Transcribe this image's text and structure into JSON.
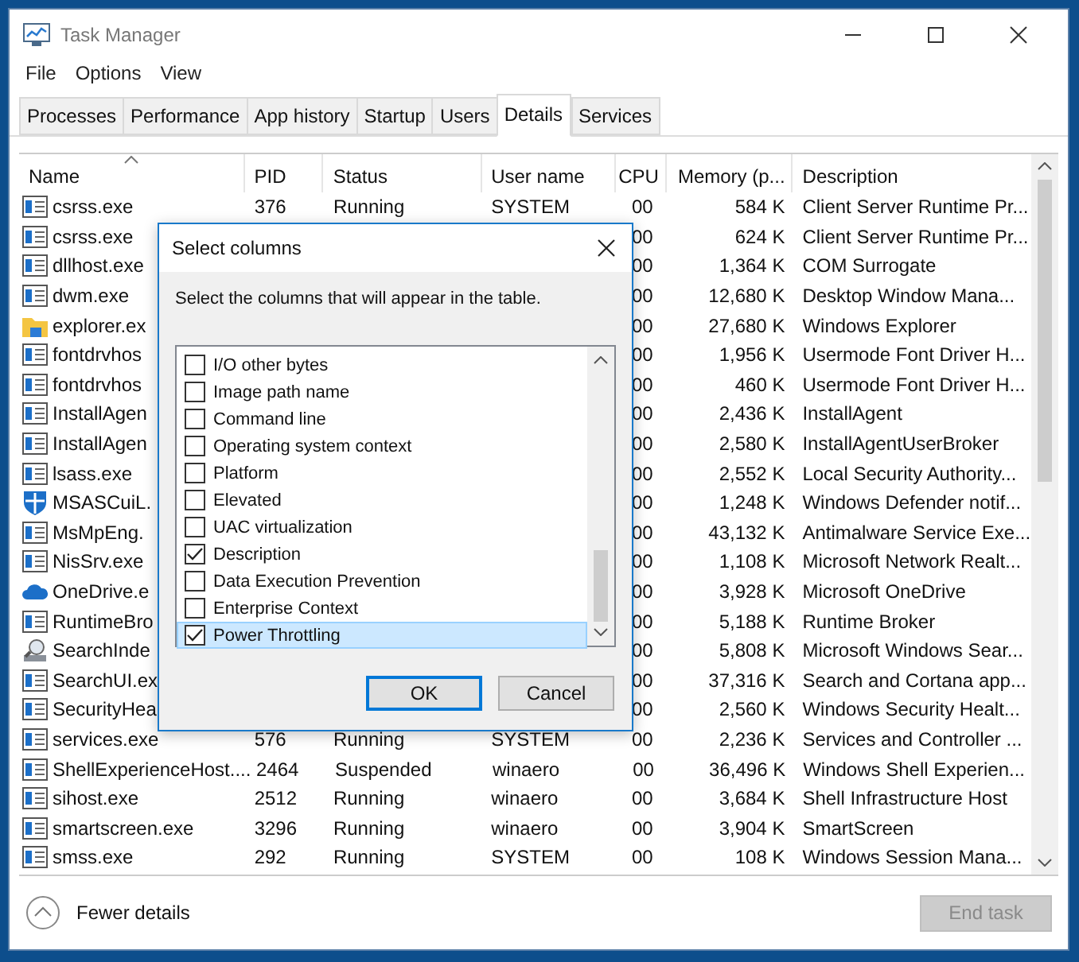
{
  "window": {
    "title": "Task Manager"
  },
  "menu": [
    "File",
    "Options",
    "View"
  ],
  "tabs": [
    {
      "label": "Processes",
      "selected": false
    },
    {
      "label": "Performance",
      "selected": false
    },
    {
      "label": "App history",
      "selected": false
    },
    {
      "label": "Startup",
      "selected": false
    },
    {
      "label": "Users",
      "selected": false
    },
    {
      "label": "Details",
      "selected": true
    },
    {
      "label": "Services",
      "selected": false
    }
  ],
  "table": {
    "columns": [
      {
        "label": "Name",
        "sorted": true
      },
      {
        "label": "PID",
        "sorted": false
      },
      {
        "label": "Status",
        "sorted": false
      },
      {
        "label": "User name",
        "sorted": false
      },
      {
        "label": "CPU",
        "sorted": false
      },
      {
        "label": "Memory (p...",
        "sorted": false
      },
      {
        "label": "Description",
        "sorted": false
      }
    ],
    "rows": [
      {
        "kind": "app",
        "name": "csrss.exe",
        "pid": "376",
        "status": "Running",
        "user": "SYSTEM",
        "cpu": "00",
        "memory": "584 K",
        "description": "Client Server Runtime Pr..."
      },
      {
        "kind": "app",
        "name": "csrss.exe",
        "cpu": "00",
        "memory": "624 K",
        "description": "Client Server Runtime Pr..."
      },
      {
        "kind": "app",
        "name": "dllhost.exe",
        "cpu": "00",
        "memory": "1,364 K",
        "description": "COM Surrogate"
      },
      {
        "kind": "app",
        "name": "dwm.exe",
        "cpu": "00",
        "memory": "12,680 K",
        "description": "Desktop Window Mana..."
      },
      {
        "kind": "folder",
        "name": "explorer.ex",
        "cpu": "00",
        "memory": "27,680 K",
        "description": "Windows Explorer"
      },
      {
        "kind": "app",
        "name": "fontdrvhos",
        "cpu": "00",
        "memory": "1,956 K",
        "description": "Usermode Font Driver H..."
      },
      {
        "kind": "app",
        "name": "fontdrvhos",
        "cpu": "00",
        "memory": "460 K",
        "description": "Usermode Font Driver H..."
      },
      {
        "kind": "app",
        "name": "InstallAgen",
        "cpu": "00",
        "memory": "2,436 K",
        "description": "InstallAgent"
      },
      {
        "kind": "app",
        "name": "InstallAgen",
        "cpu": "00",
        "memory": "2,580 K",
        "description": "InstallAgentUserBroker"
      },
      {
        "kind": "app",
        "name": "lsass.exe",
        "cpu": "00",
        "memory": "2,552 K",
        "description": "Local Security Authority..."
      },
      {
        "kind": "shield",
        "name": "MSASCuiL.",
        "cpu": "00",
        "memory": "1,248 K",
        "description": "Windows Defender notif..."
      },
      {
        "kind": "app",
        "name": "MsMpEng.",
        "cpu": "00",
        "memory": "43,132 K",
        "description": "Antimalware Service Exe..."
      },
      {
        "kind": "app",
        "name": "NisSrv.exe",
        "cpu": "00",
        "memory": "1,108 K",
        "description": "Microsoft Network Realt..."
      },
      {
        "kind": "cloud",
        "name": "OneDrive.e",
        "cpu": "00",
        "memory": "3,928 K",
        "description": "Microsoft OneDrive"
      },
      {
        "kind": "app",
        "name": "RuntimeBro",
        "cpu": "00",
        "memory": "5,188 K",
        "description": "Runtime Broker"
      },
      {
        "kind": "search",
        "name": "SearchInde",
        "cpu": "00",
        "memory": "5,808 K",
        "description": "Microsoft Windows Sear..."
      },
      {
        "kind": "app",
        "name": "SearchUI.ex",
        "cpu": "00",
        "memory": "37,316 K",
        "description": "Search and Cortana app..."
      },
      {
        "kind": "app",
        "name": "SecurityHea",
        "cpu": "00",
        "memory": "2,560 K",
        "description": "Windows Security Healt..."
      },
      {
        "kind": "app",
        "name": "services.exe",
        "pid": "576",
        "status": "Running",
        "user": "SYSTEM",
        "cpu": "00",
        "memory": "2,236 K",
        "description": "Services and Controller ..."
      },
      {
        "kind": "app",
        "name": "ShellExperienceHost....",
        "pid": "2464",
        "status": "Suspended",
        "user": "winaero",
        "cpu": "00",
        "memory": "36,496 K",
        "description": "Windows Shell Experien..."
      },
      {
        "kind": "app",
        "name": "sihost.exe",
        "pid": "2512",
        "status": "Running",
        "user": "winaero",
        "cpu": "00",
        "memory": "3,684 K",
        "description": "Shell Infrastructure Host"
      },
      {
        "kind": "app",
        "name": "smartscreen.exe",
        "pid": "3296",
        "status": "Running",
        "user": "winaero",
        "cpu": "00",
        "memory": "3,904 K",
        "description": "SmartScreen"
      },
      {
        "kind": "app",
        "name": "smss.exe",
        "pid": "292",
        "status": "Running",
        "user": "SYSTEM",
        "cpu": "00",
        "memory": "108 K",
        "description": "Windows Session Mana..."
      }
    ]
  },
  "dialog": {
    "title": "Select columns",
    "instruction": "Select the columns that will appear in the table.",
    "options": [
      {
        "label": "I/O other bytes",
        "checked": false,
        "selected": false
      },
      {
        "label": "Image path name",
        "checked": false,
        "selected": false
      },
      {
        "label": "Command line",
        "checked": false,
        "selected": false
      },
      {
        "label": "Operating system context",
        "checked": false,
        "selected": false
      },
      {
        "label": "Platform",
        "checked": false,
        "selected": false
      },
      {
        "label": "Elevated",
        "checked": false,
        "selected": false
      },
      {
        "label": "UAC virtualization",
        "checked": false,
        "selected": false
      },
      {
        "label": "Description",
        "checked": true,
        "selected": false
      },
      {
        "label": "Data Execution Prevention",
        "checked": false,
        "selected": false
      },
      {
        "label": "Enterprise Context",
        "checked": false,
        "selected": false
      },
      {
        "label": "Power Throttling",
        "checked": true,
        "selected": true
      }
    ],
    "buttons": [
      {
        "label": "OK",
        "default": true
      },
      {
        "label": "Cancel",
        "default": false
      }
    ]
  },
  "footer": {
    "toggle": "Fewer details",
    "end_task": {
      "label": "End task",
      "disabled": true
    }
  }
}
